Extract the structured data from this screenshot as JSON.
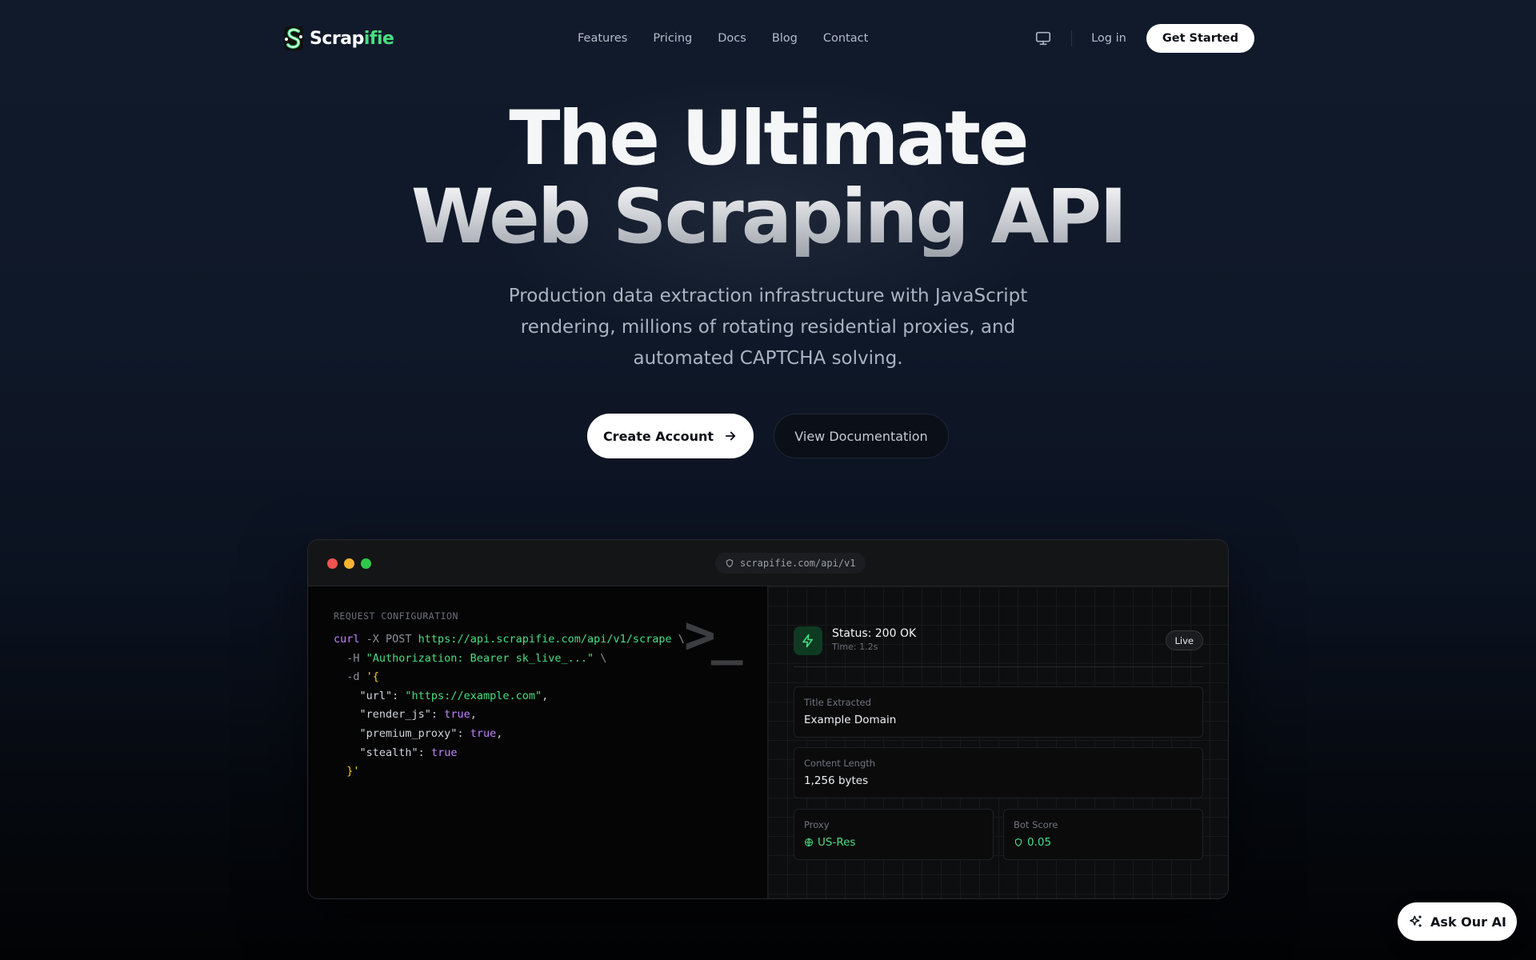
{
  "nav": {
    "logo": {
      "part1": "Scrap",
      "part2": "ifie"
    },
    "links": [
      "Features",
      "Pricing",
      "Docs",
      "Blog",
      "Contact"
    ],
    "login": "Log in",
    "get_started": "Get Started"
  },
  "hero": {
    "title_line1": "The Ultimate",
    "title_line2": "Web Scraping API",
    "subtitle": "Production data extraction infrastructure with JavaScript rendering, millions of rotating residential proxies, and automated CAPTCHA solving.",
    "create_account": "Create Account",
    "view_docs": "View Documentation"
  },
  "terminal": {
    "url": "scrapifie.com/api/v1",
    "request_label": "REQUEST CONFIGURATION",
    "code": {
      "cmd": "curl",
      "flag_x": " -X POST ",
      "endpoint": "https://api.scrapifie.com/api/v1/scrape",
      "cont1": " \\",
      "flag_h": "  -H ",
      "auth": "\"Authorization: Bearer sk_live_...\"",
      "cont2": " \\",
      "flag_d": "  -d ",
      "open": "'{",
      "k_url": "    \"url\"",
      "v_url": "\"https://example.com\"",
      "k_render": "    \"render_js\"",
      "v_true": "true",
      "k_premium": "    \"premium_proxy\"",
      "k_stealth": "    \"stealth\"",
      "close": "  }'"
    },
    "response": {
      "status": "Status: 200 OK",
      "time": "Time: 1.2s",
      "live": "Live",
      "title_label": "Title Extracted",
      "title_value": "Example Domain",
      "length_label": "Content Length",
      "length_value": "1,256 bytes",
      "proxy_label": "Proxy",
      "proxy_value": "US-Res",
      "bot_label": "Bot Score",
      "bot_value": "0.05"
    }
  },
  "ask_ai": "Ask Our AI",
  "colors": {
    "accent_green": "#4ade80",
    "keyword_purple": "#c084fc",
    "string_green": "#4ade80"
  }
}
